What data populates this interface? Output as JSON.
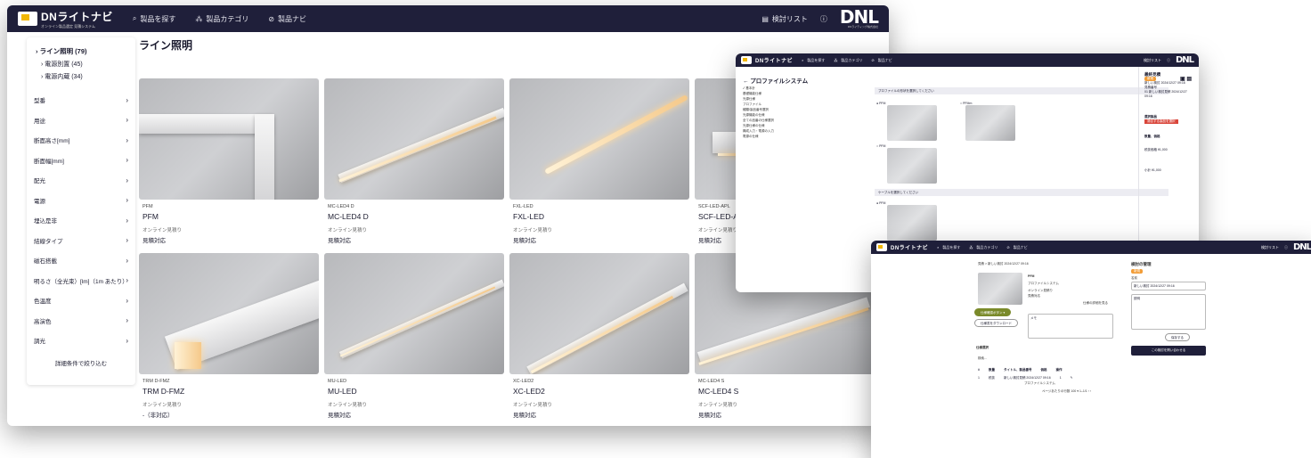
{
  "main": {
    "logo": {
      "title": "DNライトナビ",
      "subtitle": "オンライン製品選定 見積システム"
    },
    "nav": [
      {
        "icon": "search-icon",
        "label": "製品を探す"
      },
      {
        "icon": "category-icon",
        "label": "製品カテゴリ"
      },
      {
        "icon": "compass-icon",
        "label": "製品ナビ"
      }
    ],
    "wishlist_label": "検討リスト",
    "brand": {
      "name": "DNL",
      "sub": "DNライティング株式会社"
    },
    "page_title": "ライン照明",
    "tree": [
      {
        "label": "ライン照明 (79)",
        "root": true
      },
      {
        "label": "電源別置 (45)",
        "root": false
      },
      {
        "label": "電源内蔵 (34)",
        "root": false
      }
    ],
    "filters": [
      "型番",
      "用途",
      "断面高さ[mm]",
      "断面幅[mm]",
      "配光",
      "電源",
      "埋込是非",
      "結線タイプ",
      "磁石搭載",
      "明るさ（全光束）[lm]（1m あたり）",
      "色温度",
      "高演色",
      "調光"
    ],
    "filter_button": "詳細条件で絞り込む",
    "products": [
      {
        "code": "PFM",
        "name": "PFM",
        "tag": "オンライン見積り",
        "status": "見積対応"
      },
      {
        "code": "MC-LED4 D",
        "name": "MC-LED4 D",
        "tag": "オンライン見積り",
        "status": "見積対応"
      },
      {
        "code": "FXL-LED",
        "name": "FXL-LED",
        "tag": "オンライン見積り",
        "status": "見積対応"
      },
      {
        "code": "SCF-LED-APL",
        "name": "SCF-LED-APL",
        "tag": "オンライン見積り",
        "status": "見積対応"
      },
      {
        "code": "TRM D-FMZ",
        "name": "TRM D-FMZ",
        "tag": "オンライン見積り",
        "status": "-（非対応）"
      },
      {
        "code": "MU-LED",
        "name": "MU-LED",
        "tag": "オンライン見積り",
        "status": "見積対応"
      },
      {
        "code": "XC-LED2",
        "name": "XC-LED2",
        "tag": "オンライン見積り",
        "status": "見積対応"
      },
      {
        "code": "MC-LED4 S",
        "name": "MC-LED4 S",
        "tag": "オンライン見積り",
        "status": "見積対応"
      }
    ]
  },
  "config": {
    "title": "← プロファイルシステム",
    "steps": [
      "✓ 基本計",
      "基礎機能仕様",
      "光源仕様",
      "プロファイル",
      "種類/製品番号選択",
      "光源機能の仕様",
      "全ての品番の仕様選択",
      "光源仕様の仕様",
      "構成入力・電源の入力",
      "電源の仕様"
    ],
    "section1": "プロファイルの形状を選択してください",
    "opt1": "● PFM",
    "opt2": "○ PFMm",
    "opt3": "○ PFM",
    "section2": "ケーブルを選択してください",
    "opt4": "● PFM",
    "panel_head": "最終見積",
    "panel_tag": "新規",
    "panel_lines": [
      "新しい検討 2024/12/27 09:16",
      "見積番号",
      "01 新しい検討見積 2024/12/27 09:16"
    ],
    "panel_label1": "選択製品",
    "panel_red": "適合する製品を選択",
    "panel_label2": "数量、価格",
    "panel_price": "税抜価格 ¥1,000",
    "panel_sum": "小計 ¥1,000"
  },
  "quote": {
    "crumb": "見積 > 新しい検討 2024/12/27 09:16",
    "product": "PFM",
    "lines": [
      "プロファイルシステム",
      "オンライン見積り",
      "見積対応"
    ],
    "button_green": "仕様確認ボタン ▾",
    "button_outline": "仕様書をダウンロード",
    "memo": "メモ",
    "list_title": "仕様選択",
    "search": "検索...",
    "table_head": [
      "#",
      "数量",
      "タイトル、製品番号",
      "価格",
      "操作"
    ],
    "table_row": [
      "1",
      "税抜",
      "新しい検討見積 2024/12/27 09:16",
      "1",
      "✎"
    ],
    "table_sub": "プロファイルシステム",
    "pager": "ページあたりの行数  100 ▾   1–1/1   ‹  ›",
    "side_head": "検討の管理",
    "side_tag": "新規",
    "side_label": "名前",
    "side_value": "新しい検討 2024/12/27 09:16",
    "side_label2": "説明",
    "side_save": "保存する",
    "side_dark": "この検討を問い合わせる",
    "open_link": "仕様の詳細を見る"
  }
}
